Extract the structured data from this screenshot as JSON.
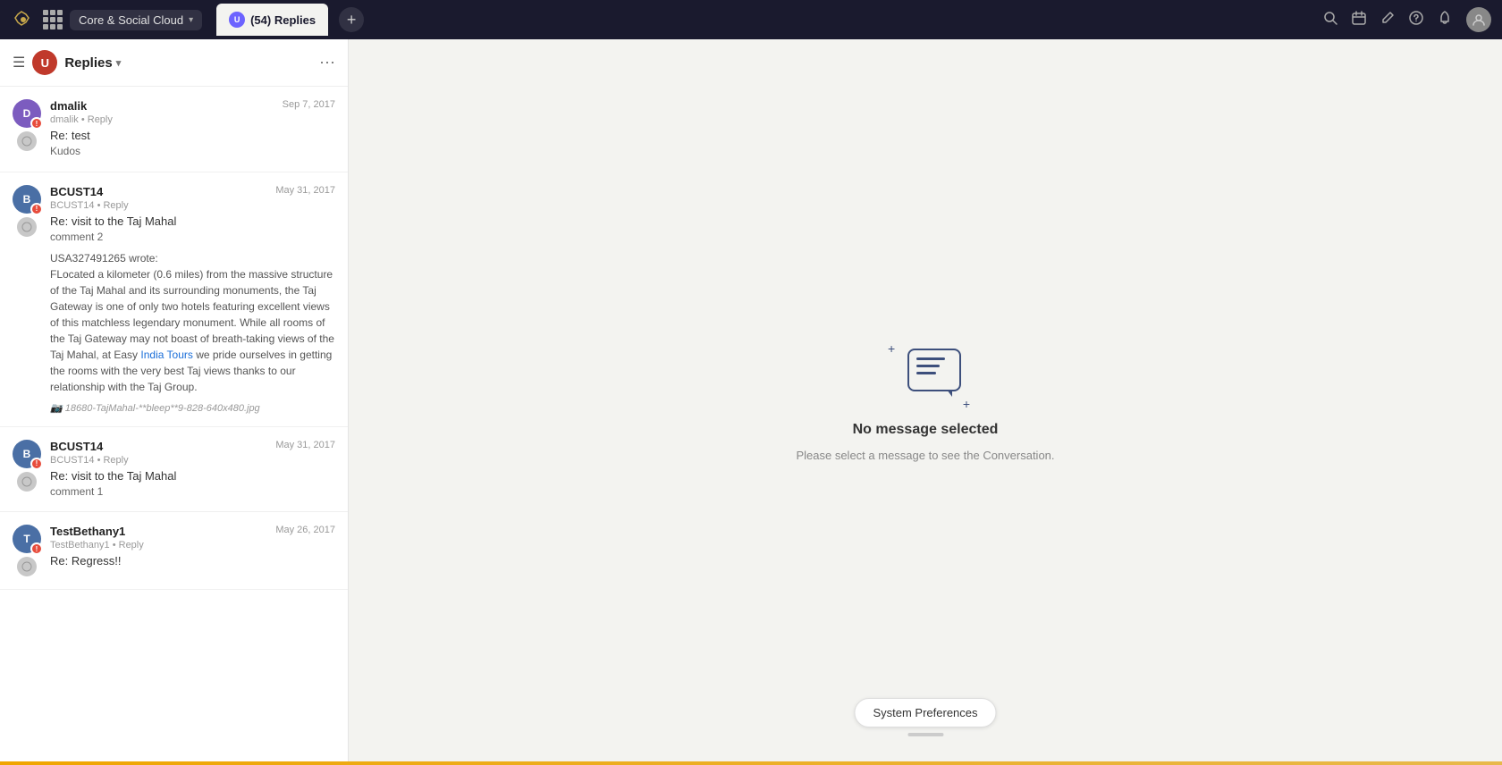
{
  "topbar": {
    "logo": "✦",
    "grid_icon": "grid-icon",
    "brand": "Core & Social Cloud",
    "brand_chevron": "▾",
    "tab_label": "(54) Replies",
    "tab_avatar_text": "U",
    "add_tab": "+",
    "icons": {
      "search": "🔍",
      "calendar": "📅",
      "edit": "✏️",
      "help": "?",
      "notification": "🔔",
      "user": "👤"
    }
  },
  "panel_header": {
    "title": "Replies",
    "chevron": "▾",
    "logo_text": "U",
    "more": "⋯"
  },
  "messages": [
    {
      "id": 1,
      "author": "dmalik",
      "meta": "dmalik • Reply",
      "date": "Sep 7, 2017",
      "subject": "Re: test",
      "body": "Kudos",
      "avatar_text": "D",
      "avatar_color": "purple",
      "has_status": true,
      "has_reply_avatar": true
    },
    {
      "id": 2,
      "author": "BCUST14",
      "meta": "BCUST14 • Reply",
      "date": "May 31, 2017",
      "subject": "Re: visit to the Taj Mahal",
      "body": "comment 2",
      "avatar_text": "B",
      "avatar_color": "blue",
      "has_status": true,
      "has_reply_avatar": true,
      "quote_author": "USA327491265 wrote:",
      "quote_body": "FLocated a kilometer (0.6 miles) from the massive structure of the Taj Mahal and its surrounding monuments, the Taj Gateway is one of only two hotels featuring excellent views of this matchless legendary monument. While all rooms of the Taj Gateway may not boast of breath-taking views of the Taj Mahal, at Easy India Tours we pride ourselves in getting the rooms with the very best Taj views thanks to our relationship with the Taj Group.",
      "quote_link": "India Tours",
      "image_placeholder": "18680-TajMahal-**bleep**9-828-640x480.jpg"
    },
    {
      "id": 3,
      "author": "BCUST14",
      "meta": "BCUST14 • Reply",
      "date": "May 31, 2017",
      "subject": "Re: visit to the Taj Mahal",
      "body": "comment 1",
      "avatar_text": "B",
      "avatar_color": "blue",
      "has_status": true,
      "has_reply_avatar": true
    },
    {
      "id": 4,
      "author": "TestBethany1",
      "meta": "TestBethany1 • Reply",
      "date": "May 26, 2017",
      "subject": "Re: Regress!!",
      "body": "",
      "avatar_text": "T",
      "avatar_color": "blue",
      "has_status": true,
      "has_reply_avatar": true
    }
  ],
  "right_panel": {
    "no_message_title": "No message selected",
    "no_message_subtitle": "Please select a message to see the Conversation."
  },
  "system_prefs": {
    "button_label": "System Preferences"
  }
}
